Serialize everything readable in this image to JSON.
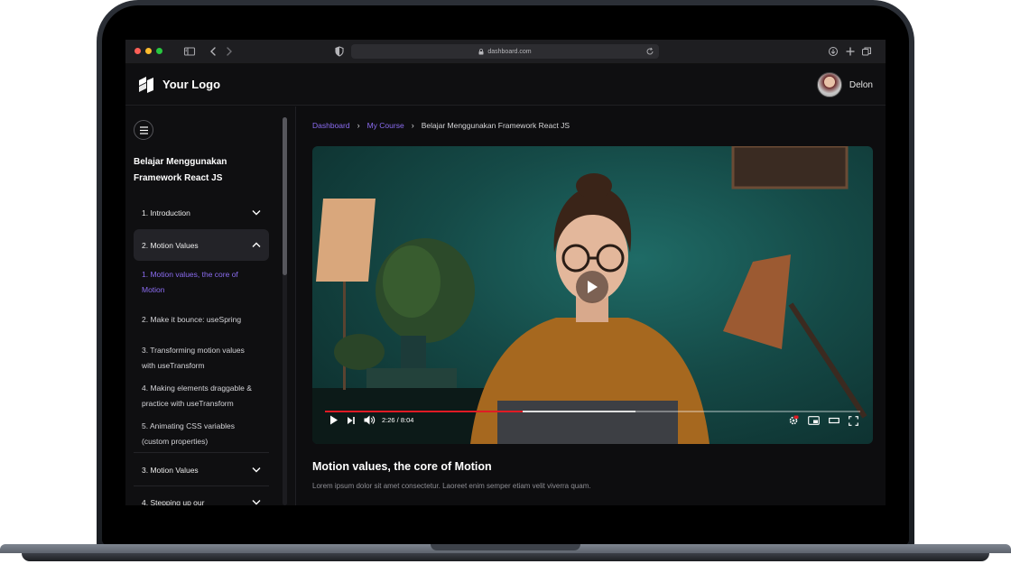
{
  "browser": {
    "url": "dashboard.com"
  },
  "header": {
    "logo_text": "Your Logo",
    "user_name": "Delon"
  },
  "sidebar": {
    "course_title": "Belajar Menggunakan Framework React JS",
    "sections": [
      {
        "label": "1. Introduction",
        "expanded": false
      },
      {
        "label": "2. Motion Values",
        "expanded": true
      },
      {
        "label": "3. Motion Values",
        "expanded": false
      },
      {
        "label": "4. Stepping up our",
        "expanded": false
      }
    ],
    "lessons": [
      {
        "label": "1. Motion values, the core of Motion",
        "current": true
      },
      {
        "label": "2. Make it bounce: useSpring",
        "current": false
      },
      {
        "label": "3. Transforming motion values with useTransform",
        "current": false
      },
      {
        "label": "4. Making elements draggable & practice with useTransform",
        "current": false
      },
      {
        "label": "5. Animating CSS variables (custom properties)",
        "current": false
      }
    ]
  },
  "breadcrumb": {
    "items": [
      "Dashboard",
      "My Course",
      "Belajar Menggunakan Framework React JS"
    ]
  },
  "video": {
    "time_display": "2:26 / 8:04",
    "played_fraction": 0.37,
    "buffered_fraction": 0.58
  },
  "lesson": {
    "title": "Motion values, the core of Motion",
    "description": "Lorem ipsum dolor sit amet consectetur. Laoreet enim semper etiam velit viverra quam."
  },
  "colors": {
    "accent": "#8b6cf1",
    "progress": "#e01b24",
    "background": "#0d0d0f"
  }
}
